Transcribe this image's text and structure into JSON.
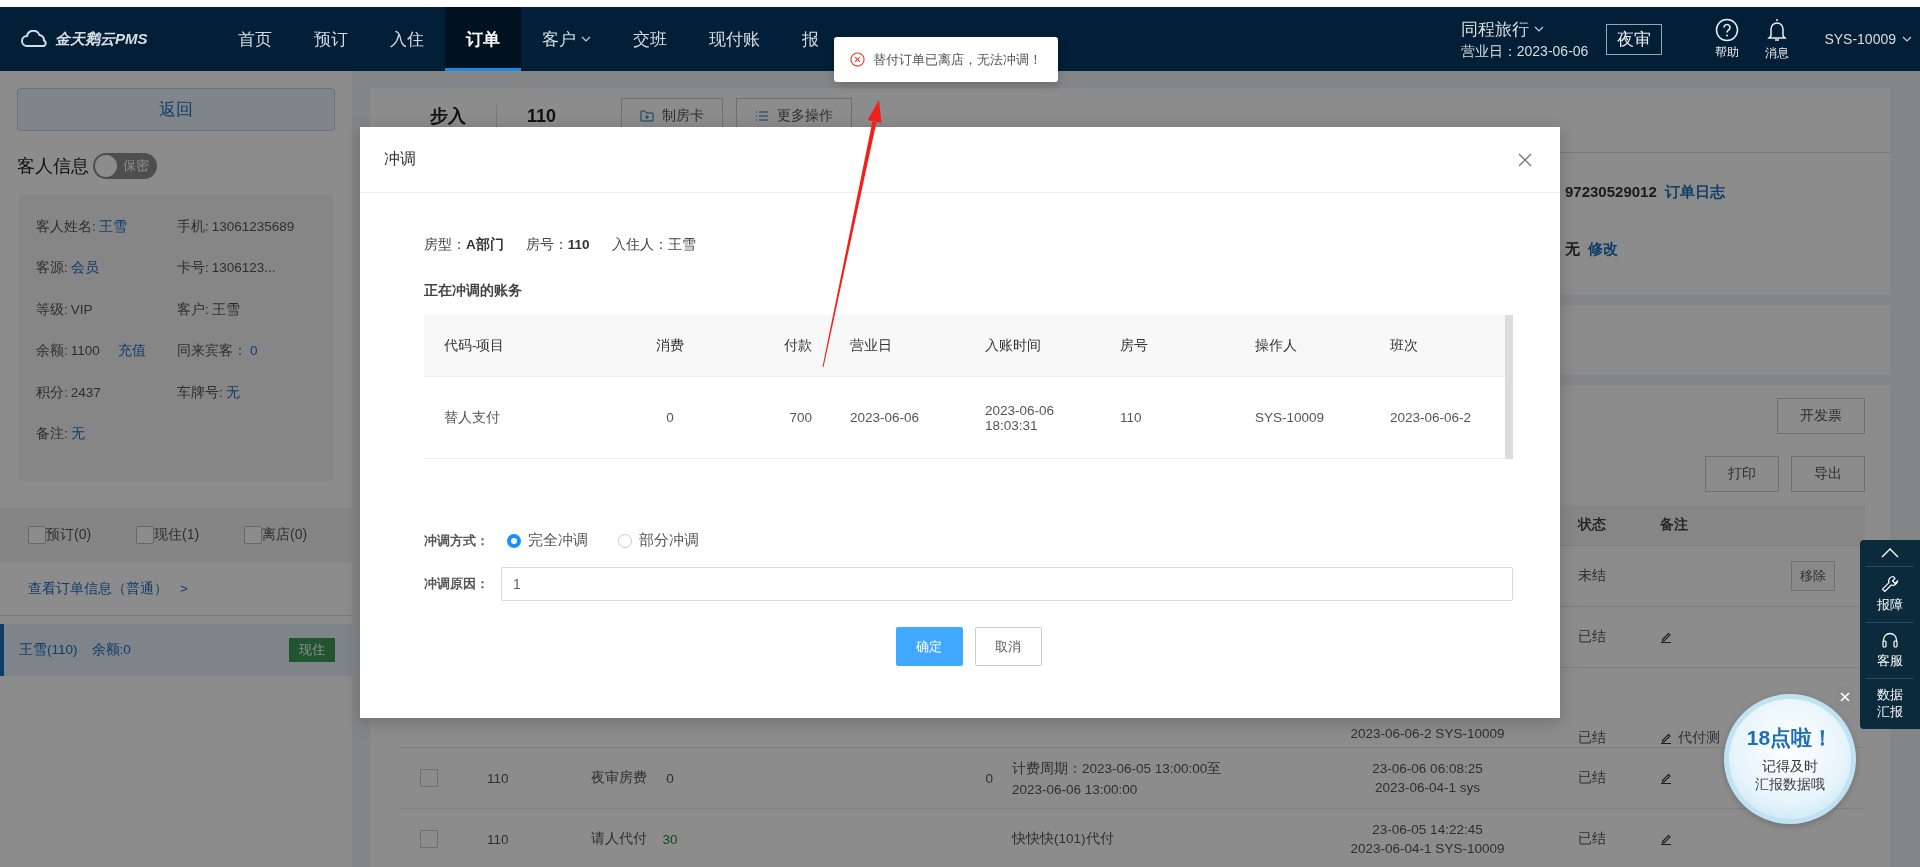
{
  "nav": {
    "logo": "金天鹅云PMS",
    "items": [
      {
        "label": "首页",
        "selected": false,
        "dropdown": false
      },
      {
        "label": "预订",
        "selected": false,
        "dropdown": false
      },
      {
        "label": "入住",
        "selected": false,
        "dropdown": false
      },
      {
        "label": "订单",
        "selected": true,
        "dropdown": false
      },
      {
        "label": "客户",
        "selected": false,
        "dropdown": true
      },
      {
        "label": "交班",
        "selected": false,
        "dropdown": false
      },
      {
        "label": "现付账",
        "selected": false,
        "dropdown": false
      },
      {
        "label": "报",
        "selected": false,
        "dropdown": false
      }
    ],
    "hotel": "同程旅行",
    "business_date": "营业日：2023-06-06",
    "night_audit": "夜审",
    "help": "帮助",
    "messages": "消息",
    "user": "SYS-10009"
  },
  "toast": {
    "kind": "error",
    "text": "替付订单已离店，无法冲调！"
  },
  "sidebar": {
    "back": "返回",
    "title": "客人信息",
    "privacy_switch": {
      "label": "保密",
      "on": false
    },
    "guest_fields": [
      {
        "label": "客人姓名:",
        "value": "王雪",
        "link": true
      },
      {
        "label": "手机:",
        "value": "13061235689",
        "link": false
      },
      {
        "label": "客源:",
        "value": "会员",
        "link": true
      },
      {
        "label": "卡号:",
        "value": "1306123...",
        "link": false
      },
      {
        "label": "等级:",
        "value": "VIP",
        "link": false
      },
      {
        "label": "客户:",
        "value": "王雪",
        "link": false
      },
      {
        "label": "余额:",
        "value": "1100",
        "link": false,
        "action": "充值"
      },
      {
        "label": "同来宾客：",
        "value": "0",
        "link": true
      },
      {
        "label": "积分:",
        "value": "2437",
        "link": false
      },
      {
        "label": "车牌号:",
        "value": "无",
        "link": true
      },
      {
        "label": "备注:",
        "value": "无",
        "link": true
      }
    ],
    "filters": [
      {
        "label": "预订(0)",
        "checked": false
      },
      {
        "label": "现住(1)",
        "checked": false
      },
      {
        "label": "离店(0)",
        "checked": false
      }
    ],
    "order_info_link": "查看订单信息（普通）",
    "link_chevron": ">",
    "rooms": [
      {
        "name": "王雪(110)",
        "balance": "余额:0",
        "status": "现住",
        "selected": true
      }
    ]
  },
  "main": {
    "check_in_type": "步入",
    "room": "110",
    "buttons": [
      "制房卡",
      "更多操作"
    ],
    "order_no": "97230529012",
    "order_log": "订单日志",
    "remark_value": "无",
    "edit_link": "修改",
    "invoice_button": "开发票",
    "print_button": "打印",
    "export_button": "导出",
    "columns": [
      "状态",
      "备注"
    ],
    "rows": [
      {
        "status": "未结",
        "kind": "button",
        "remark": "移除"
      },
      {
        "status": "已结",
        "kind": "edit"
      },
      {
        "time": [
          "2023-06-06-2 SYS-10009"
        ],
        "status": "已结",
        "kind": "edit",
        "remark": "代付测"
      },
      {
        "checked": false,
        "room": "110",
        "item": "夜审房费",
        "consume": "0",
        "consume_highlight": false,
        "pay": "0",
        "desc": [
          "计费周期：2023-06-05 13:00:00至",
          "2023-06-06 13:00:00"
        ],
        "time": [
          "23-06-06 06:08:25",
          "2023-06-04-1 sys"
        ],
        "status": "已结",
        "kind": "edit"
      },
      {
        "checked": false,
        "room": "110",
        "item": "请人代付",
        "consume": "30",
        "consume_highlight": true,
        "desc": [
          "快快快(101)代付"
        ],
        "time": [
          "23-06-05 14:22:45",
          "2023-06-04-1 SYS-10009"
        ],
        "status": "已结",
        "kind": "edit"
      }
    ]
  },
  "modal": {
    "title": "冲调",
    "info": [
      "房型：**A部门**",
      "房号：**110**",
      "入住人：王雪"
    ],
    "section_title": "正在冲调的账务",
    "table": {
      "columns": [
        "代码-项目",
        "消费",
        "付款",
        "营业日",
        "入账时间",
        "房号",
        "操作人",
        "班次"
      ],
      "rows": [
        [
          "替人支付",
          "0",
          "700",
          "2023-06-06",
          "2023-06-06 18:03:31",
          "110",
          "SYS-10009",
          "2023-06-06-2"
        ]
      ]
    },
    "method_label": "冲调方式：",
    "methods": [
      {
        "label": "完全冲调",
        "selected": true
      },
      {
        "label": "部分冲调",
        "selected": false
      }
    ],
    "reason_label": "冲调原因：",
    "reason_value": "1",
    "confirm": "确定",
    "cancel": "取消"
  },
  "float_bar": {
    "items": [
      {
        "kind": "top"
      },
      {
        "kind": "tool",
        "label": "报障"
      },
      {
        "kind": "headset",
        "label": "客服"
      },
      {
        "kind": "text",
        "label": "数据汇报"
      }
    ]
  },
  "bubble": {
    "headline": "18点啦！",
    "lines": [
      "记得及时",
      "汇报数据哦"
    ]
  }
}
